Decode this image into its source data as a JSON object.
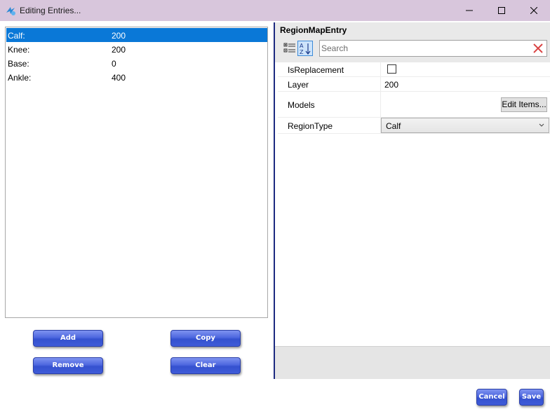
{
  "window": {
    "title": "Editing Entries..."
  },
  "entries": [
    {
      "key": "Calf:",
      "value": "200",
      "selected": true
    },
    {
      "key": "Knee:",
      "value": "200",
      "selected": false
    },
    {
      "key": "Base:",
      "value": "0",
      "selected": false
    },
    {
      "key": "Ankle:",
      "value": "400",
      "selected": false
    }
  ],
  "buttons": {
    "add": "Add",
    "copy": "Copy",
    "remove": "Remove",
    "clear": "Clear",
    "cancel": "Cancel",
    "save": "Save"
  },
  "property_grid": {
    "object_type": "RegionMapEntry",
    "search_placeholder": "Search",
    "properties": {
      "is_replacement": {
        "name": "IsReplacement",
        "checked": false
      },
      "layer": {
        "name": "Layer",
        "value": "200"
      },
      "models": {
        "name": "Models",
        "button": "Edit Items..."
      },
      "region_type": {
        "name": "RegionType",
        "value": "Calf"
      }
    }
  },
  "colors": {
    "selection": "#0a78d7",
    "titlebar": "#d8c6dc",
    "button_blue": "#4d67df",
    "divider": "#1c2a80"
  }
}
